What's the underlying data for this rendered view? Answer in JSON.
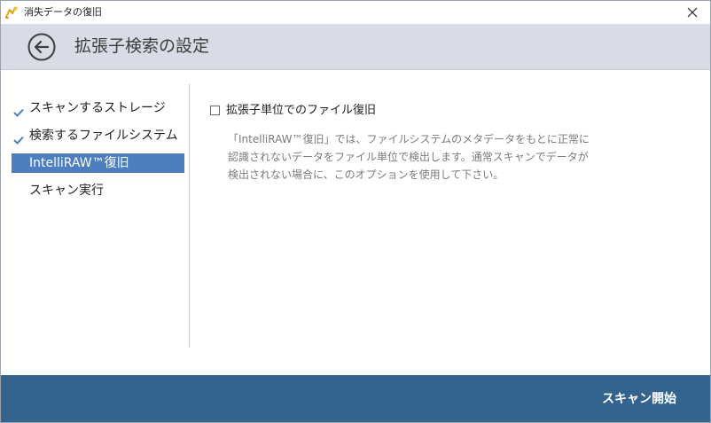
{
  "window": {
    "title": "消失データの復旧"
  },
  "header": {
    "title": "拡張子検索の設定"
  },
  "sidebar": {
    "steps": [
      {
        "label": "スキャンするストレージ",
        "checked": true
      },
      {
        "label": "検索するファイルシステム",
        "checked": true
      },
      {
        "label": "IntelliRAW™復旧",
        "active": true
      },
      {
        "label": "スキャン実行"
      }
    ]
  },
  "main": {
    "option_label": "拡張子単位でのファイル復旧",
    "option_checked": false,
    "description_lines": [
      "「IntelliRAW™復旧」では、ファイルシステムのメタデータをもとに正常に",
      "認識されないデータをファイル単位で検出します。通常スキャンでデータが",
      "検出されない場合に、このオプションを使用して下さい。"
    ]
  },
  "footer": {
    "start_label": "スキャン開始"
  },
  "colors": {
    "header_bg": "#d9dce7",
    "active_step_bg": "#4c7ec0",
    "footer_bg": "#34648e",
    "check_color": "#4c7ec0"
  }
}
